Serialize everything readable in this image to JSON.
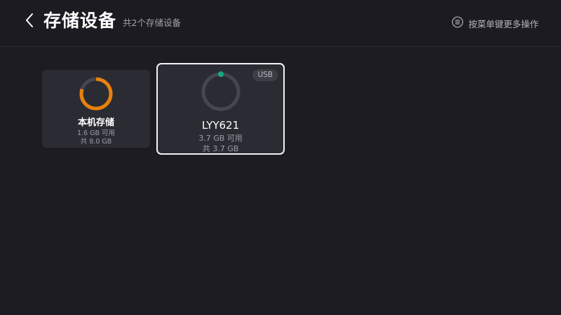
{
  "header": {
    "title": "存储设备",
    "subtitle": "共2个存储设备",
    "menu_hint": "按菜单键更多操作",
    "back_icon": "chevron-left-icon",
    "menu_icon": "menu-lines-icon"
  },
  "devices": [
    {
      "name": "本机存储",
      "available": "1.6 GB 可用",
      "total": "共 8.0 GB",
      "used_fraction": 0.8,
      "ring_color": "#e8820c",
      "track_color": "#46474e",
      "selected": false
    },
    {
      "name": "LYY621",
      "available": "3.7 GB 可用",
      "total": "共 3.7 GB",
      "badge": "USB",
      "used_fraction": 0.0,
      "ring_color": "#18a882",
      "track_color": "#46474e",
      "selected": true
    }
  ],
  "colors": {
    "background": "#1c1c22",
    "card": "#2b2c33",
    "focus_border": "#f4f4f4",
    "accent_orange": "#e8820c",
    "accent_green": "#18a882"
  }
}
